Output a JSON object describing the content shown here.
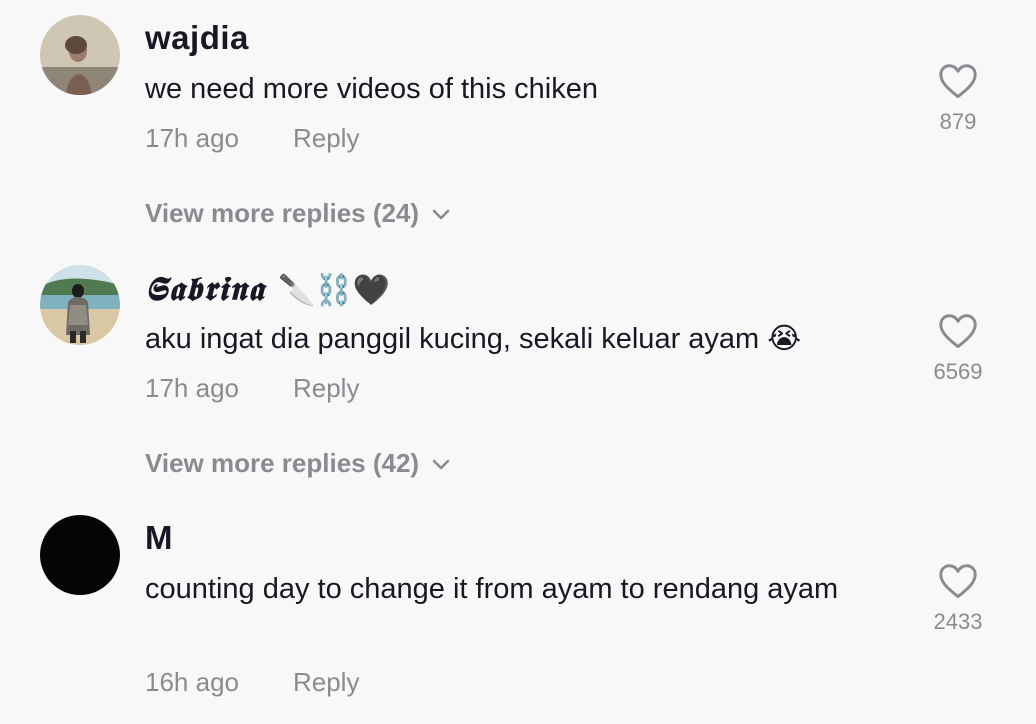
{
  "comments": [
    {
      "username": "wajdia",
      "text": "we need more videos of this chiken",
      "time": "17h ago",
      "reply_label": "Reply",
      "likes": "879",
      "view_more": "View more replies (24)",
      "avatar_icon": "user-photo-avatar"
    },
    {
      "username": "𝕾𝖆𝖇𝖗𝖎𝖓𝖆",
      "username_emoji": "🔪⛓️🖤",
      "text": "aku ingat dia panggil kucing, sekali keluar ayam 😭",
      "time": "17h ago",
      "reply_label": "Reply",
      "likes": "6569",
      "view_more": "View more replies (42)",
      "avatar_icon": "beach-photo-avatar"
    },
    {
      "username": "M",
      "text": "counting day to change it from ayam to rendang ayam",
      "time": "16h ago",
      "reply_label": "Reply",
      "likes": "2433",
      "avatar_icon": "black-avatar"
    }
  ],
  "colors": {
    "background": "#f8f8f8",
    "primary_text": "#161823",
    "secondary_text": "#8a8b91"
  },
  "icons": {
    "like": "heart-outline-icon",
    "expand": "chevron-down-icon"
  }
}
